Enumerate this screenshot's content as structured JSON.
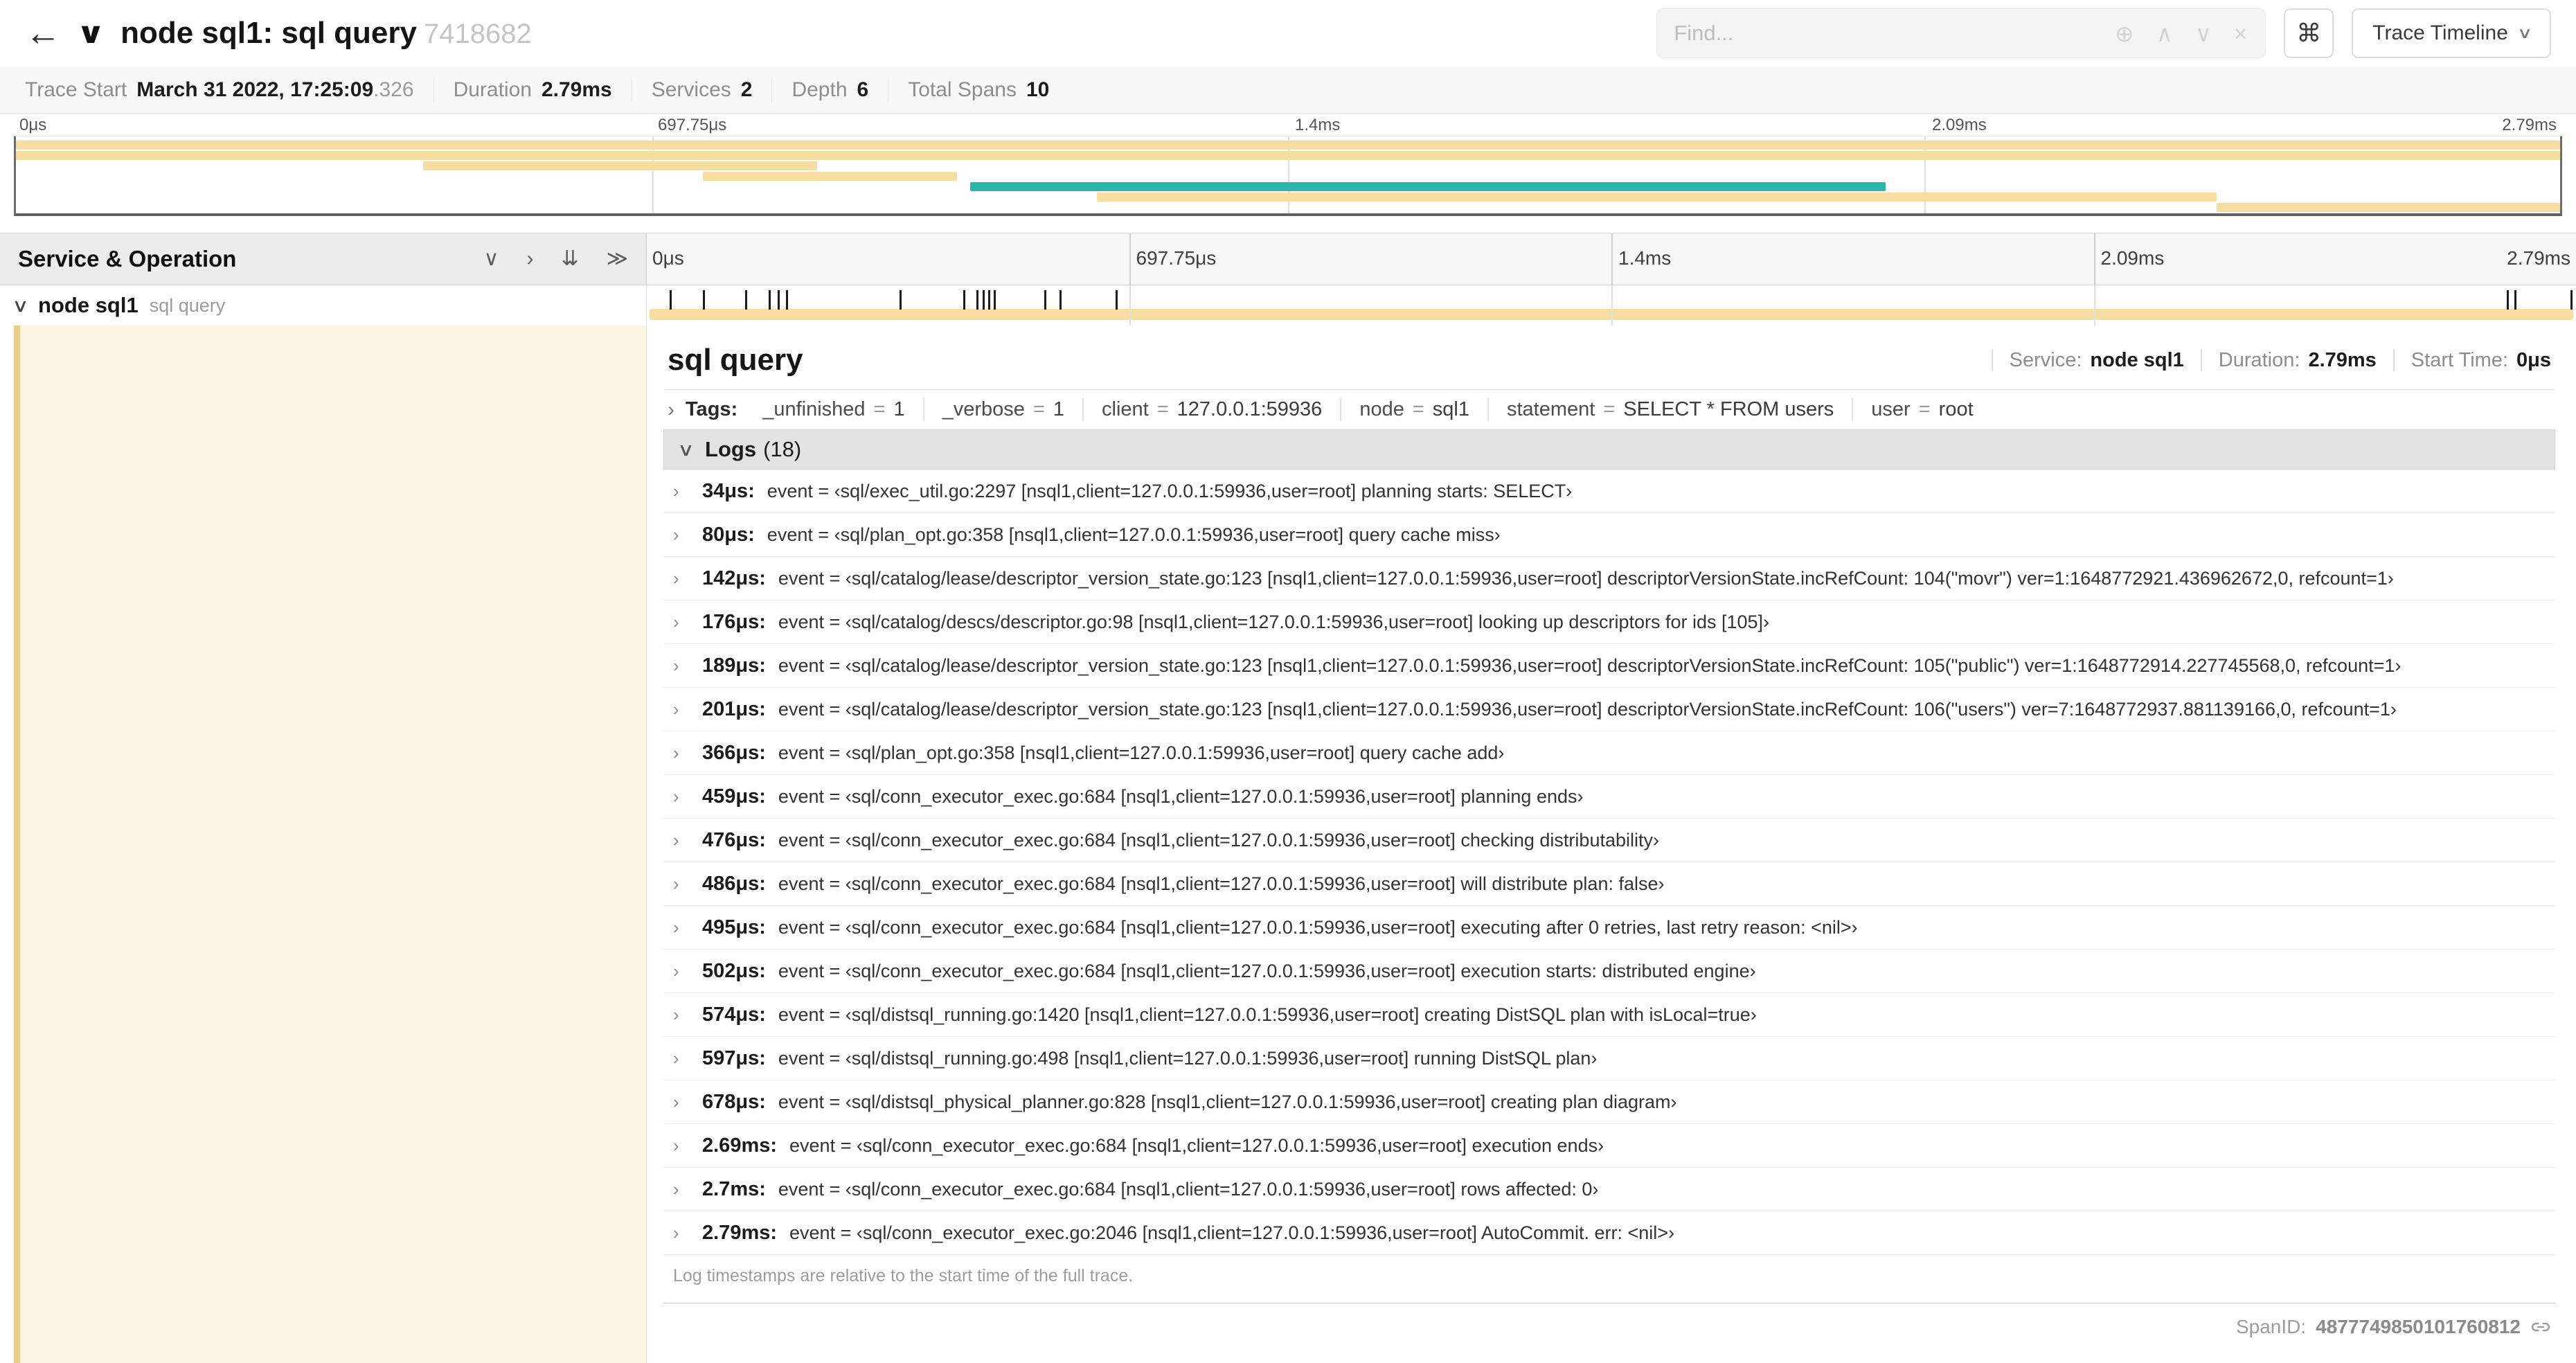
{
  "header": {
    "back_icon": "←",
    "collapse_icon": "∨",
    "title": "node sql1: sql query",
    "trace_id": "7418682",
    "find_placeholder": "Find...",
    "icons": {
      "locate": "⊕",
      "prev": "∧",
      "next": "∨",
      "clear": "×",
      "dropdown": "∨"
    },
    "shortcut_key": "⌘",
    "view_button": "Trace Timeline"
  },
  "summary": {
    "items": [
      {
        "label": "Trace Start",
        "value": "March 31 2022, 17:25:09",
        "suffix": ".326"
      },
      {
        "label": "Duration",
        "value": "2.79ms",
        "suffix": ""
      },
      {
        "label": "Services",
        "value": "2",
        "suffix": ""
      },
      {
        "label": "Depth",
        "value": "6",
        "suffix": ""
      },
      {
        "label": "Total Spans",
        "value": "10",
        "suffix": ""
      }
    ]
  },
  "colors": {
    "tan": "#F7DDA0",
    "teal": "#2BB5AB",
    "cream": "#FBF4E1",
    "cream_accent": "#EBCD8D",
    "marker": "#1C1C1C"
  },
  "minimap": {
    "bars": [
      {
        "row": 0,
        "start": 0,
        "end": 100,
        "color": "tan"
      },
      {
        "row": 1,
        "start": 0,
        "end": 100,
        "color": "tan"
      },
      {
        "row": 2,
        "start": 16,
        "end": 31.5,
        "color": "tan"
      },
      {
        "row": 3,
        "start": 27,
        "end": 37,
        "color": "tan"
      },
      {
        "row": 4,
        "start": 37.5,
        "end": 73.5,
        "color": "teal"
      },
      {
        "row": 5,
        "start": 42.5,
        "end": 86.5,
        "color": "tan"
      },
      {
        "row": 6,
        "start": 86.5,
        "end": 100,
        "color": "tan"
      }
    ]
  },
  "timeline": {
    "left_header": "Service & Operation",
    "collapse_icons": {
      "collapse_one": "∨",
      "expand_one": "›",
      "collapse_all": "⇊",
      "expand_all": "≫"
    },
    "ticks": [
      "0μs",
      "697.75μs",
      "1.4ms",
      "2.09ms",
      "2.79ms"
    ],
    "tick_positions": [
      0,
      25,
      50,
      75,
      100
    ],
    "row": {
      "chevron": "∨",
      "service": "node sql1",
      "operation": "sql query"
    },
    "log_marker_positions": [
      1.2,
      2.9,
      5.1,
      6.3,
      6.8,
      7.2,
      13.1,
      16.4,
      17.1,
      17.4,
      17.7,
      18.0,
      20.6,
      21.4,
      24.3,
      96.4,
      96.8,
      99.7
    ]
  },
  "detail": {
    "title": "sql query",
    "meta": [
      {
        "label": "Service:",
        "value": "node sql1"
      },
      {
        "label": "Duration:",
        "value": "2.79ms"
      },
      {
        "label": "Start Time:",
        "value": "0μs"
      }
    ],
    "tags_chevron": "›",
    "tags_label": "Tags:",
    "tags": [
      {
        "key": "_unfinished",
        "value": "1"
      },
      {
        "key": "_verbose",
        "value": "1"
      },
      {
        "key": "client",
        "value": "127.0.0.1:59936"
      },
      {
        "key": "node",
        "value": "sql1"
      },
      {
        "key": "statement",
        "value": "SELECT * FROM users"
      },
      {
        "key": "user",
        "value": "root"
      }
    ],
    "logs_chevron": "∨",
    "logs_label": "Logs",
    "logs_count": "(18)",
    "log_chevron": "›",
    "logs": [
      {
        "time": "34μs:",
        "text": "event = ‹sql/exec_util.go:2297 [nsql1,client=127.0.0.1:59936,user=root] planning starts: SELECT›"
      },
      {
        "time": "80μs:",
        "text": "event = ‹sql/plan_opt.go:358 [nsql1,client=127.0.0.1:59936,user=root] query cache miss›"
      },
      {
        "time": "142μs:",
        "text": "event = ‹sql/catalog/lease/descriptor_version_state.go:123 [nsql1,client=127.0.0.1:59936,user=root] descriptorVersionState.incRefCount: 104(\"movr\") ver=1:1648772921.436962672,0, refcount=1›"
      },
      {
        "time": "176μs:",
        "text": "event = ‹sql/catalog/descs/descriptor.go:98 [nsql1,client=127.0.0.1:59936,user=root] looking up descriptors for ids [105]›"
      },
      {
        "time": "189μs:",
        "text": "event = ‹sql/catalog/lease/descriptor_version_state.go:123 [nsql1,client=127.0.0.1:59936,user=root] descriptorVersionState.incRefCount: 105(\"public\") ver=1:1648772914.227745568,0, refcount=1›"
      },
      {
        "time": "201μs:",
        "text": "event = ‹sql/catalog/lease/descriptor_version_state.go:123 [nsql1,client=127.0.0.1:59936,user=root] descriptorVersionState.incRefCount: 106(\"users\") ver=7:1648772937.881139166,0, refcount=1›"
      },
      {
        "time": "366μs:",
        "text": "event = ‹sql/plan_opt.go:358 [nsql1,client=127.0.0.1:59936,user=root] query cache add›"
      },
      {
        "time": "459μs:",
        "text": "event = ‹sql/conn_executor_exec.go:684 [nsql1,client=127.0.0.1:59936,user=root] planning ends›"
      },
      {
        "time": "476μs:",
        "text": "event = ‹sql/conn_executor_exec.go:684 [nsql1,client=127.0.0.1:59936,user=root] checking distributability›"
      },
      {
        "time": "486μs:",
        "text": "event = ‹sql/conn_executor_exec.go:684 [nsql1,client=127.0.0.1:59936,user=root] will distribute plan: false›"
      },
      {
        "time": "495μs:",
        "text": "event = ‹sql/conn_executor_exec.go:684 [nsql1,client=127.0.0.1:59936,user=root] executing after 0 retries, last retry reason: <nil>›"
      },
      {
        "time": "502μs:",
        "text": "event = ‹sql/conn_executor_exec.go:684 [nsql1,client=127.0.0.1:59936,user=root] execution starts: distributed engine›"
      },
      {
        "time": "574μs:",
        "text": "event = ‹sql/distsql_running.go:1420 [nsql1,client=127.0.0.1:59936,user=root] creating DistSQL plan with isLocal=true›"
      },
      {
        "time": "597μs:",
        "text": "event = ‹sql/distsql_running.go:498 [nsql1,client=127.0.0.1:59936,user=root] running DistSQL plan›"
      },
      {
        "time": "678μs:",
        "text": "event = ‹sql/distsql_physical_planner.go:828 [nsql1,client=127.0.0.1:59936,user=root] creating plan diagram›"
      },
      {
        "time": "2.69ms:",
        "text": "event = ‹sql/conn_executor_exec.go:684 [nsql1,client=127.0.0.1:59936,user=root] execution ends›"
      },
      {
        "time": "2.7ms:",
        "text": "event = ‹sql/conn_executor_exec.go:684 [nsql1,client=127.0.0.1:59936,user=root] rows affected: 0›"
      },
      {
        "time": "2.79ms:",
        "text": "event = ‹sql/conn_executor_exec.go:2046 [nsql1,client=127.0.0.1:59936,user=root] AutoCommit. err: <nil>›"
      }
    ],
    "logs_footnote": "Log timestamps are relative to the start time of the full trace.",
    "spanid_label": "SpanID:",
    "spanid_value": "4877749850101760812"
  },
  "misc": {
    "eq": "="
  }
}
